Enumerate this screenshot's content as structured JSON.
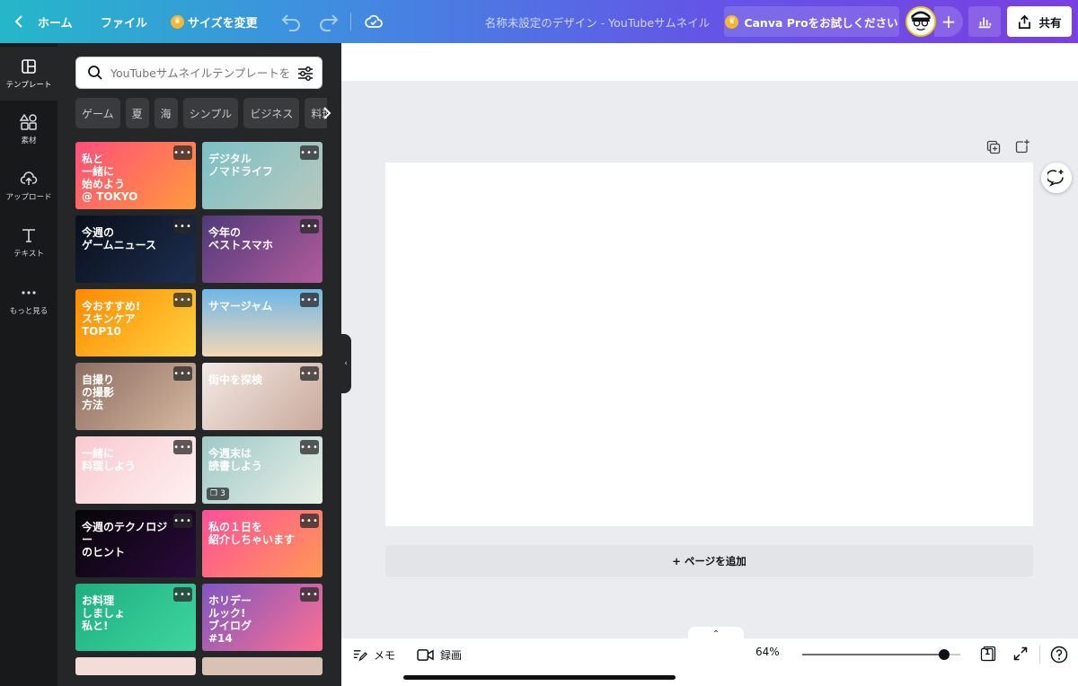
{
  "topbar": {
    "home_label": "ホーム",
    "file_label": "ファイル",
    "resize_label": "サイズを変更",
    "title": "名称未設定のデザイン - YouTubeサムネイル",
    "pro_label": "Canva Proをお試しください",
    "plus_label": "+",
    "share_label": "共有"
  },
  "rail": {
    "items": [
      {
        "label": "テンプレート",
        "icon": "template-icon"
      },
      {
        "label": "素材",
        "icon": "elements-icon"
      },
      {
        "label": "アップロード",
        "icon": "upload-icon"
      },
      {
        "label": "テキスト",
        "icon": "text-icon"
      },
      {
        "label": "もっと見る",
        "icon": "more-icon"
      }
    ]
  },
  "panel": {
    "search_placeholder": "YouTubeサムネイルテンプレートを検索",
    "chips": [
      "ゲーム",
      "夏",
      "海",
      "シンプル",
      "ビジネス",
      "料理"
    ],
    "templates": [
      {
        "text": "私と\n一緒に\n始めよう\n@ TOKYO",
        "bg": "linear-gradient(135deg,#ff4f7b,#ff9a3c)",
        "badge": ""
      },
      {
        "text": "デジタル\nノマドライフ",
        "bg": "linear-gradient(135deg,#7bc0c6,#b9c8bd)",
        "badge": ""
      },
      {
        "text": "今週の\nゲームニュース",
        "bg": "linear-gradient(135deg,#0a0f1a,#1c2e4f)",
        "badge": ""
      },
      {
        "text": "今年の\nベストスマホ",
        "bg": "linear-gradient(135deg,#503a7a,#b25c9b)",
        "badge": ""
      },
      {
        "text": "今おすすめ!\nスキンケア\nTOP10",
        "bg": "linear-gradient(135deg,#ff8a00,#ffd23f)",
        "badge": ""
      },
      {
        "text": "サマージャム",
        "bg": "linear-gradient(180deg,#6fb7e8,#f2d7b5)",
        "badge": ""
      },
      {
        "text": "自撮り\nの撮影\n方法",
        "bg": "linear-gradient(135deg,#8d6e63,#d7b8a0)",
        "badge": ""
      },
      {
        "text": "街中を探検",
        "bg": "linear-gradient(135deg,#f3e9e4,#c9a99b)",
        "badge": ""
      },
      {
        "text": "一緒に\n料理しよう",
        "bg": "linear-gradient(135deg,#f8c9cf,#fff1f1)",
        "badge": ""
      },
      {
        "text": "今週末は\n読書しよう",
        "bg": "linear-gradient(135deg,#9ec9c7,#e8efe6)",
        "badge": "3"
      },
      {
        "text": "今週のテクノロジー\nのヒント",
        "bg": "linear-gradient(135deg,#050505,#2b0a3d)",
        "badge": ""
      },
      {
        "text": "私の１日を\n紹介しちゃいます",
        "bg": "linear-gradient(135deg,#ff4f9a,#ff9955)",
        "badge": ""
      },
      {
        "text": "お料理\nしましょ\n私と!",
        "bg": "linear-gradient(135deg,#1fae7f,#3dd6a0)",
        "badge": ""
      },
      {
        "text": "ホリデー\nルック!\nブイログ\n#14",
        "bg": "linear-gradient(135deg,#7e57c2,#ff6f91)",
        "badge": ""
      }
    ]
  },
  "canvas": {
    "add_page_label": "+ ページを追加"
  },
  "bottombar": {
    "memo_label": "メモ",
    "record_label": "録画",
    "zoom_label": "64%",
    "zoom_value": 0.64,
    "page_count": "1"
  }
}
